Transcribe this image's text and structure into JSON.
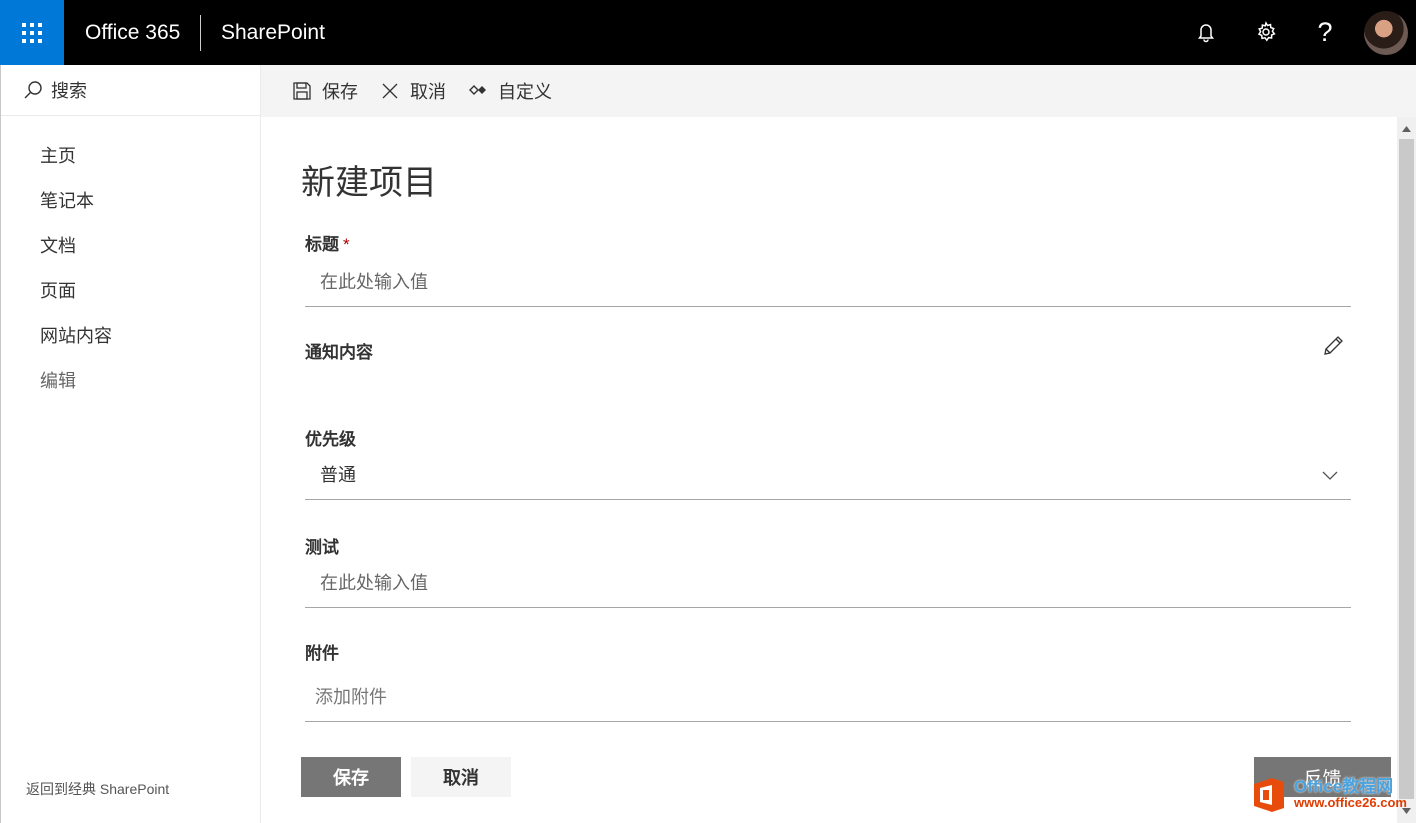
{
  "suitebar": {
    "brand": "Office 365",
    "app_name": "SharePoint",
    "help_glyph": "?",
    "icons": [
      "app-launcher-icon",
      "bell-icon",
      "gear-icon",
      "help-icon"
    ],
    "accent_color": "#0078d7"
  },
  "leftnav": {
    "search_label": "搜索",
    "items": [
      {
        "label": "主页"
      },
      {
        "label": "笔记本"
      },
      {
        "label": "文档"
      },
      {
        "label": "页面"
      },
      {
        "label": "网站内容"
      },
      {
        "label": "编辑"
      }
    ],
    "back_classic": "返回到经典 SharePoint"
  },
  "cmdbar": {
    "save": "保存",
    "cancel": "取消",
    "customize": "自定义"
  },
  "form": {
    "title": "新建项目",
    "fields": {
      "title_label": "标题",
      "required_mark": "*",
      "title_placeholder": "在此处输入值",
      "notice_label": "通知内容",
      "priority_label": "优先级",
      "priority_value": "普通",
      "test_label": "测试",
      "test_placeholder": "在此处输入值",
      "attachment_label": "附件",
      "attachment_action": "添加附件"
    },
    "save_button": "保存",
    "cancel_button": "取消",
    "feedback_button": "反馈"
  },
  "watermark": {
    "brand": "Office教程网",
    "url": "www.office26.com"
  }
}
